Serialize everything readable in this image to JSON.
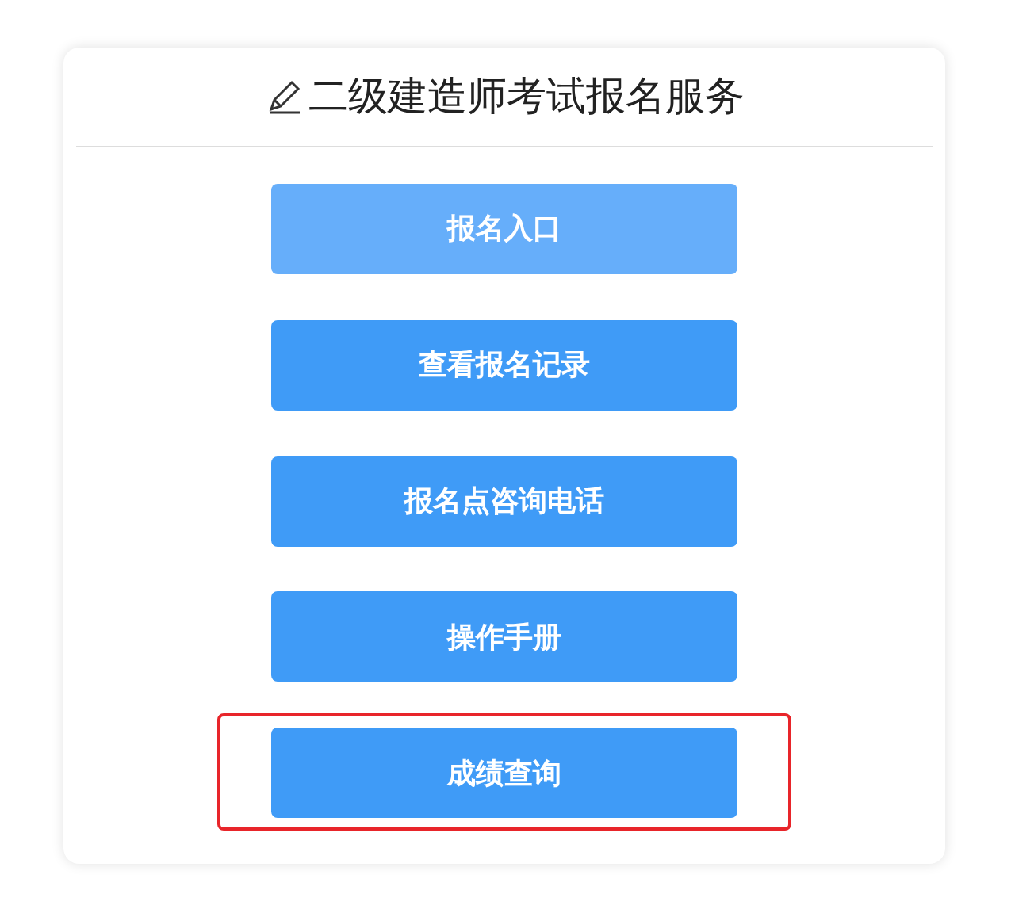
{
  "title": "二级建造师考试报名服务",
  "buttons": [
    {
      "label": "报名入口",
      "hovered": true,
      "marked": false
    },
    {
      "label": "查看报名记录",
      "hovered": false,
      "marked": false
    },
    {
      "label": "报名点咨询电话",
      "hovered": false,
      "marked": false
    },
    {
      "label": "操作手册",
      "hovered": false,
      "marked": false
    },
    {
      "label": "成绩查询",
      "hovered": false,
      "marked": true
    }
  ]
}
